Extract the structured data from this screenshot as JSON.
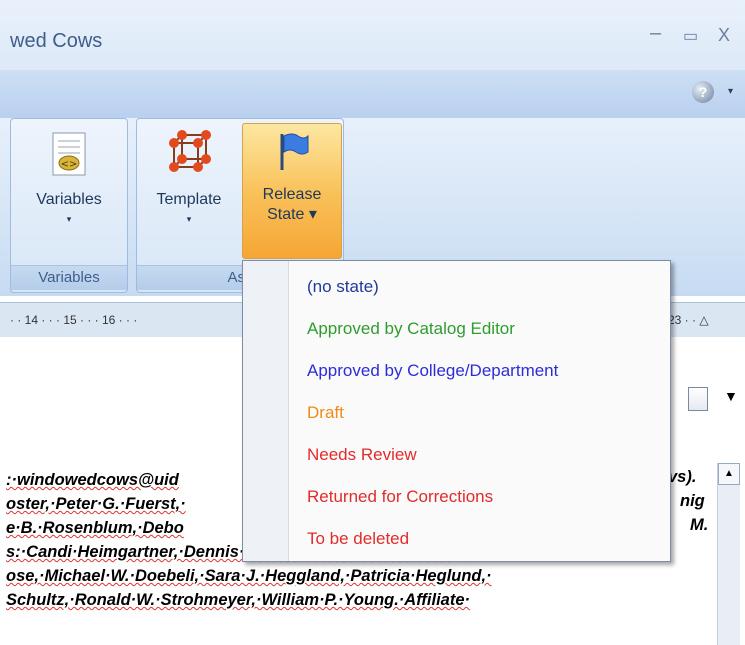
{
  "window": {
    "title": "wed Cows",
    "minimize_glyph": "–",
    "maximize_glyph": "▭",
    "close_glyph": "X"
  },
  "helpbar": {
    "help_glyph": "?",
    "caret": "▾"
  },
  "ribbon": {
    "buttons": [
      {
        "label": "Variables",
        "caret": "▾"
      },
      {
        "label": "Template",
        "caret": "▾"
      },
      {
        "label_line1": "Release",
        "label_line2": "State ▾"
      }
    ],
    "groups": [
      {
        "label": "Variables"
      },
      {
        "label": "Ass"
      }
    ]
  },
  "ruler": {
    "left_text": "· · 14 · · · 15 · · · 16 · · ·",
    "right_text": "23 · · △"
  },
  "dropdown": {
    "items": [
      {
        "label": "(no state)",
        "color": "#1f3a99"
      },
      {
        "label": "Approved by Catalog Editor",
        "color": "#2e9d2e"
      },
      {
        "label": "Approved by College/Department",
        "color": "#2d2dd8"
      },
      {
        "label": "Draft",
        "color": "#f08a18"
      },
      {
        "label": "Needs Review",
        "color": "#e22b2b"
      },
      {
        "label": "Returned for Corrections",
        "color": "#e22b2b"
      },
      {
        "label": "To be deleted",
        "color": "#e22b2b"
      }
    ]
  },
  "document": {
    "lines": [
      ":·windowedcows@uid",
      "oster,·Peter·G.·Fuerst,·",
      "e·B.·Rosenblum,·Debo",
      "s:·Candi·Heimgartner,·Dennis·Johnsen,·Bruce·K.·Mobarry,·",
      "ose,·Michael·W.·Doebeli,·Sara·J.·Heggland,·Patricia·Heglund,·",
      "Schultz,·Ronald·W.·Strohmeyer,·William·P.·Young.·Affiliate·"
    ],
    "right_fragments": [
      "vs).",
      "nig",
      "M."
    ]
  }
}
